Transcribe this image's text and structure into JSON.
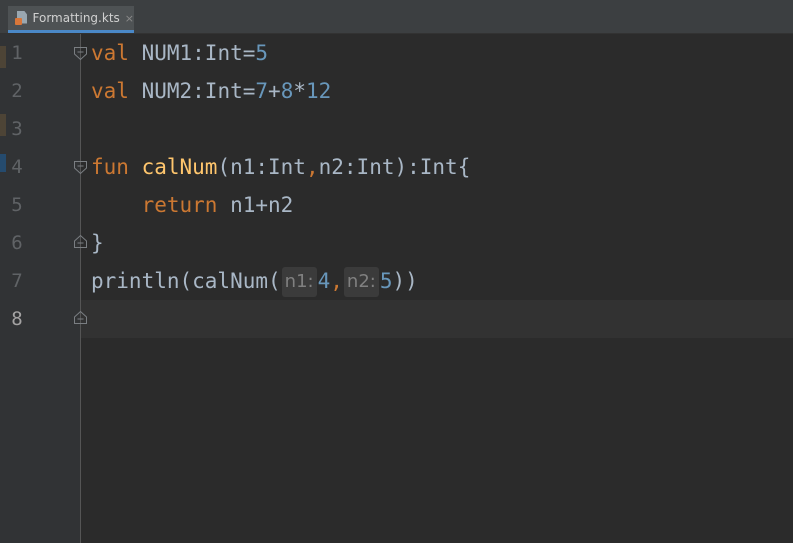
{
  "tab": {
    "filename": "Formatting.kts",
    "close_glyph": "×",
    "icon": "kotlin-script-file-icon"
  },
  "gutter": {
    "line_numbers": [
      "1",
      "2",
      "3",
      "4",
      "5",
      "6",
      "7",
      "8"
    ],
    "current_line": "8"
  },
  "code": {
    "line1": {
      "kw": "val",
      "text": " NUM1:Int=",
      "num": "5"
    },
    "line2": {
      "kw": "val",
      "text": " NUM2:Int=",
      "n1": "7",
      "op1": "+",
      "n2": "8",
      "op2": "*",
      "n3": "12"
    },
    "line4": {
      "kw": "fun",
      "space": " ",
      "fn": "calNum",
      "params_a": "(n1:Int",
      "comma": ",",
      "params_b": "n2:Int):Int{"
    },
    "line5": {
      "indent": "    ",
      "kw": "return",
      "text": " n1+n2"
    },
    "line6": {
      "text": "}"
    },
    "line7": {
      "text": "println(calNum(",
      "hint1": "n1:",
      "arg1": "4",
      "comma": ",",
      "hint2": "n2:",
      "arg2": "5",
      "close": "))"
    }
  },
  "colors": {
    "keyword": "#cc7832",
    "number": "#6897bb",
    "function": "#ffc66d",
    "text": "#a9b7c6",
    "background": "#2b2b2b",
    "gutter": "#313335"
  }
}
